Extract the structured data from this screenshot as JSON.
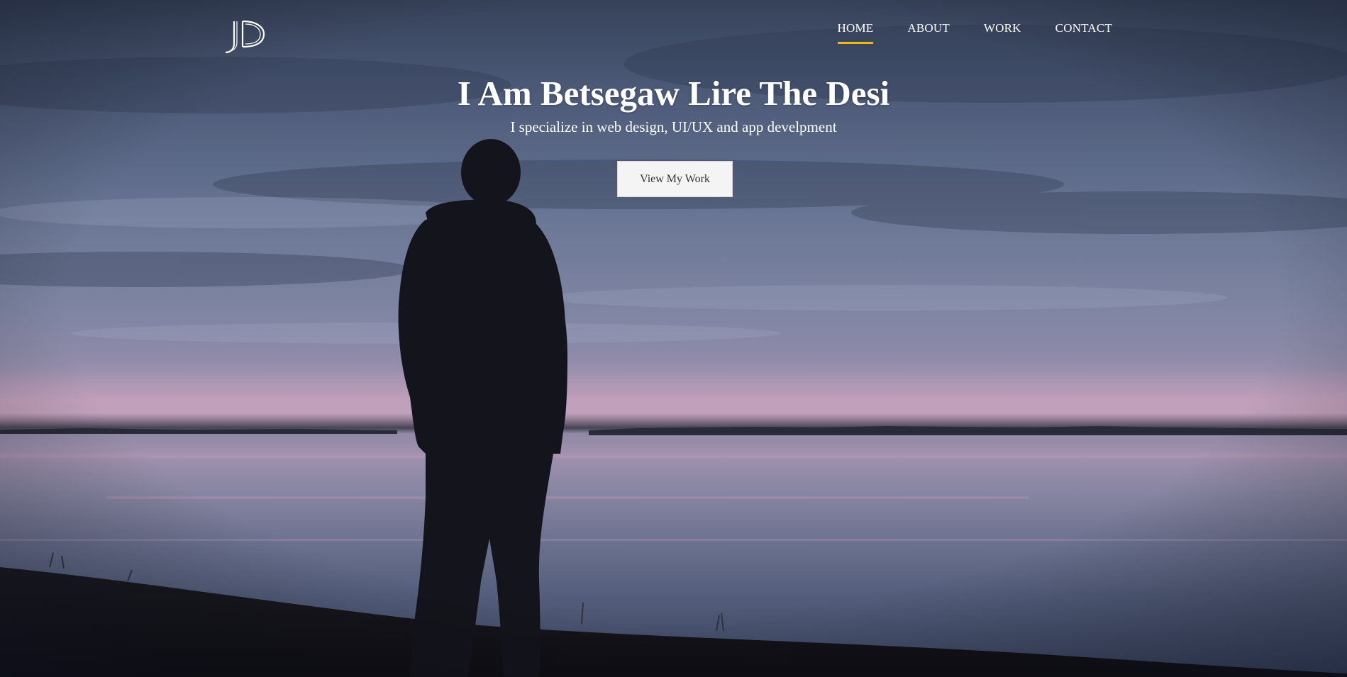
{
  "logo": {
    "text": "JD",
    "icon": "jd-monogram-logo"
  },
  "nav": {
    "items": [
      {
        "label": "HOME",
        "active": true
      },
      {
        "label": "ABOUT",
        "active": false
      },
      {
        "label": "WORK",
        "active": false
      },
      {
        "label": "CONTACT",
        "active": false
      }
    ]
  },
  "hero": {
    "title": "I Am Betsegaw Lire The Desi",
    "subtitle": "I specialize in web design, UI/UX and app develpment",
    "cta_label": "View My Work"
  },
  "colors": {
    "accent": "#f2b90f",
    "text": "#ffffff",
    "button_bg": "#f4f4f4",
    "button_text": "#333333"
  }
}
